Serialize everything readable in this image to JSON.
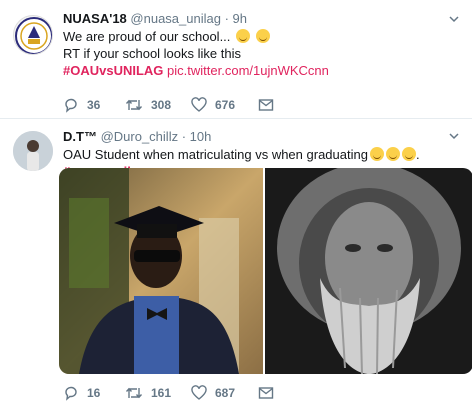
{
  "tweets": [
    {
      "name": "NUASA'18",
      "handle": "@nuasa_unilag",
      "dot": "·",
      "time": "9h",
      "line1": "We are proud of our school...",
      "line2": "RT if your school looks like this",
      "hashtag": "#OAUvsUNILAG",
      "link": "pic.twitter.com/1ujnWKCcnn",
      "replies": "36",
      "retweets": "308",
      "likes": "676"
    },
    {
      "name": "D.T™",
      "handle": "@Duro_chillz",
      "dot": "·",
      "time": "10h",
      "text": "OAU Student when matriculating vs when graduating",
      "hashtag": "#oauvsunilag",
      "replies": "16",
      "retweets": "161",
      "likes": "687"
    }
  ],
  "colors": {
    "hashtag": "#e0245e",
    "muted": "#657786",
    "text": "#14171a",
    "divider": "#e6ecf0"
  },
  "icons": [
    "reply-icon",
    "retweet-icon",
    "like-icon",
    "direct-message-icon",
    "caret-down-icon",
    "emoji-icon"
  ]
}
